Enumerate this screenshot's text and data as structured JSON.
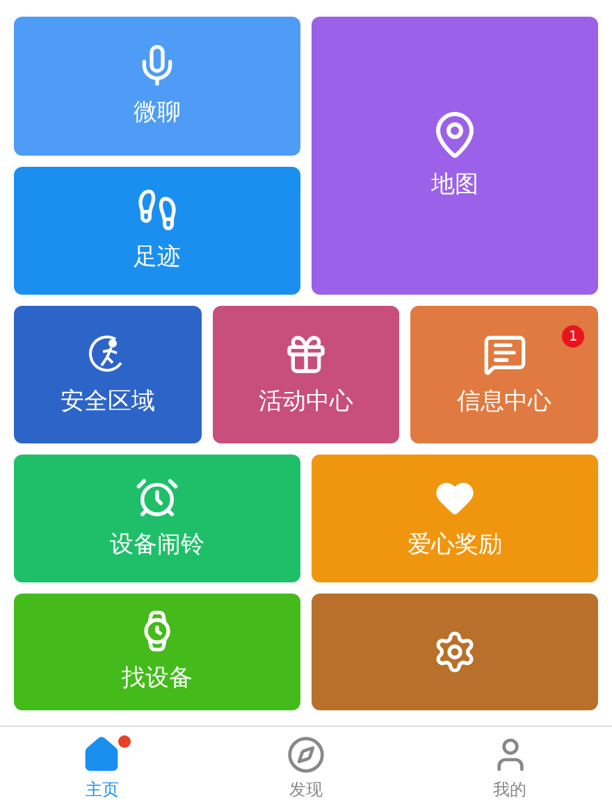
{
  "tiles": [
    {
      "label": "微聊",
      "color": "#4e9cf5"
    },
    {
      "label": "足迹",
      "color": "#1a8ff0"
    },
    {
      "label": "地图",
      "color": "#9b61e8"
    },
    {
      "label": "安全区域",
      "color": "#2d64c8"
    },
    {
      "label": "活动中心",
      "color": "#c84f7c"
    },
    {
      "label": "信息中心",
      "color": "#e07a40",
      "badge": "1"
    },
    {
      "label": "设备闹铃",
      "color": "#1fbf6a"
    },
    {
      "label": "爱心奖励",
      "color": "#f0960e"
    },
    {
      "label": "找设备",
      "color": "#44bb1a"
    },
    {
      "color": "#b8702a"
    }
  ],
  "nav": [
    {
      "label": "主页",
      "selected": true,
      "dot": true
    },
    {
      "label": "发现",
      "selected": false,
      "dot": false
    },
    {
      "label": "我的",
      "selected": false,
      "dot": false
    }
  ]
}
